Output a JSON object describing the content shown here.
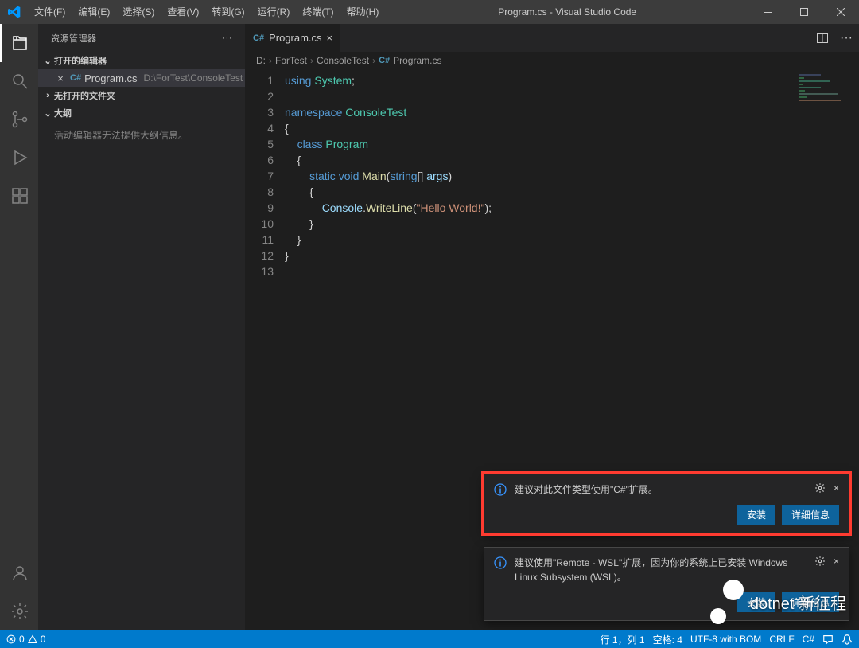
{
  "titlebar": {
    "menus": [
      "文件(F)",
      "编辑(E)",
      "选择(S)",
      "查看(V)",
      "转到(G)",
      "运行(R)",
      "终端(T)",
      "帮助(H)"
    ],
    "title": "Program.cs - Visual Studio Code"
  },
  "activitybar": {
    "top": [
      "explorer-icon",
      "search-icon",
      "source-control-icon",
      "run-debug-icon",
      "extensions-icon"
    ],
    "bottom": [
      "account-icon",
      "settings-gear-icon"
    ]
  },
  "sidebar": {
    "title": "资源管理器",
    "sections": {
      "openEditors": {
        "label": "打开的编辑器"
      },
      "openFile": {
        "name": "Program.cs",
        "path": "D:\\ForTest\\ConsoleTest"
      },
      "noFolder": {
        "label": "无打开的文件夹"
      },
      "outline": {
        "label": "大纲",
        "message": "活动编辑器无法提供大纲信息。"
      }
    }
  },
  "editor": {
    "tab": {
      "name": "Program.cs"
    },
    "breadcrumbs": [
      "D:",
      "ForTest",
      "ConsoleTest",
      "Program.cs"
    ],
    "code": {
      "lines": [
        1,
        2,
        3,
        4,
        5,
        6,
        7,
        8,
        9,
        10,
        11,
        12,
        13
      ],
      "l1_using": "using",
      "l1_sys": "System",
      "l1_semi": ";",
      "l3_ns": "namespace",
      "l3_name": "ConsoleTest",
      "l4": "{",
      "l5_kw": "class",
      "l5_name": "Program",
      "l6": "    {",
      "l7_static": "static",
      "l7_void": "void",
      "l7_main": "Main",
      "l7_paren1": "(",
      "l7_string": "string",
      "l7_arr": "[] ",
      "l7_args": "args",
      "l7_paren2": ")",
      "l8": "        {",
      "l9_console": "Console",
      "l9_dot": ".",
      "l9_wl": "WriteLine",
      "l9_p1": "(",
      "l9_str": "\"Hello World!\"",
      "l9_p2": ");",
      "l10": "        }",
      "l11": "    }",
      "l12": "}"
    }
  },
  "notifications": [
    {
      "message": "建议对此文件类型使用\"C#\"扩展。",
      "actions": {
        "install": "安装",
        "details": "详细信息"
      }
    },
    {
      "message": "建议使用\"Remote - WSL\"扩展，因为你的系统上已安装 Windows Linux Subsystem (WSL)。",
      "actions": {
        "install": "安装",
        "details": "详细信息"
      }
    }
  ],
  "statusbar": {
    "errors": "0",
    "warnings": "0",
    "lineCol": "行 1，列 1",
    "spaces": "空格: 4",
    "encoding": "UTF-8 with BOM",
    "eol": "CRLF",
    "lang": "C#"
  },
  "watermark": "dotnet 新征程"
}
